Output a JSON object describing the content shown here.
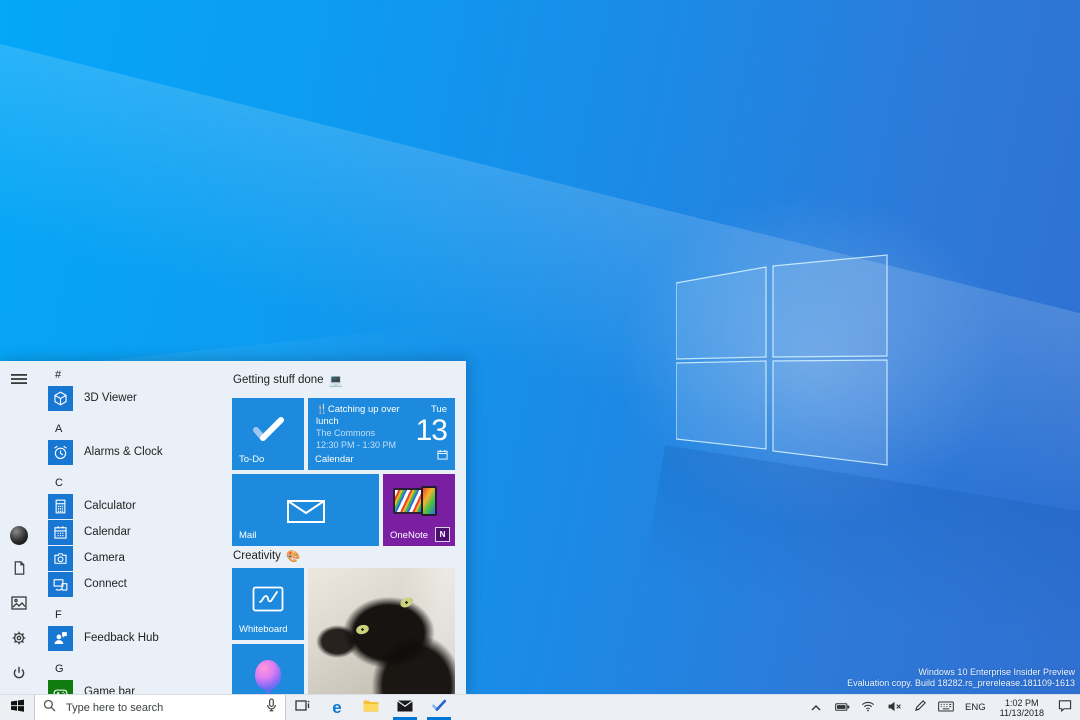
{
  "wallpaper": {
    "watermark_line1": "Windows 10 Enterprise Insider Preview",
    "watermark_line2": "Evaluation copy. Build 18282.rs_prerelease.181109-1613"
  },
  "colors": {
    "accent": "#0078d7",
    "tile_blue": "#1e8add",
    "app_icon_blue": "#1877d2",
    "onenote_purple": "#7a1fa2",
    "gamebar_green": "#107c10",
    "taskbar_bg": "#eceff4",
    "menu_bg": "#e9f0f7",
    "desktop_blue": "#0f9bef"
  },
  "icons": {
    "rail": [
      "hamburger-icon",
      "user-avatar",
      "documents-icon",
      "pictures-icon",
      "settings-gear-icon",
      "power-icon"
    ],
    "taskbar": [
      "start-icon",
      "search-icon",
      "microphone-icon",
      "task-view-icon",
      "edge-icon",
      "file-explorer-icon",
      "mail-icon",
      "todo-icon"
    ],
    "tray": [
      "chevron-up-icon",
      "battery-icon",
      "wifi-icon",
      "volume-muted-icon",
      "pen-icon",
      "touch-keyboard-icon",
      "action-center-icon"
    ]
  },
  "start_menu": {
    "sections": [
      {
        "letter": "#",
        "apps": [
          {
            "name": "3D Viewer"
          }
        ]
      },
      {
        "letter": "A",
        "apps": [
          {
            "name": "Alarms & Clock"
          }
        ]
      },
      {
        "letter": "C",
        "apps": [
          {
            "name": "Calculator"
          },
          {
            "name": "Calendar"
          },
          {
            "name": "Camera"
          },
          {
            "name": "Connect"
          }
        ]
      },
      {
        "letter": "F",
        "apps": [
          {
            "name": "Feedback Hub"
          }
        ]
      },
      {
        "letter": "G",
        "apps": [
          {
            "name": "Game bar"
          }
        ]
      }
    ],
    "groups": [
      {
        "title": "Getting stuff done",
        "emoji": "💻"
      },
      {
        "title": "Creativity",
        "emoji": "🎨"
      }
    ],
    "tiles": {
      "todo": {
        "label": "To-Do"
      },
      "calendar": {
        "label": "Calendar",
        "event_emoji": "🍴",
        "event_title": "Catching up over lunch",
        "event_location": "The Commons",
        "event_time": "12:30 PM - 1:30 PM",
        "weekday": "Tue",
        "day": "13"
      },
      "mail": {
        "label": "Mail"
      },
      "onenote": {
        "label": "OneNote",
        "badge": "N"
      },
      "whiteboard": {
        "label": "Whiteboard"
      }
    }
  },
  "taskbar": {
    "search_placeholder": "Type here to search",
    "edge_glyph": "e",
    "tray": {
      "language": "ENG",
      "time": "1:02 PM",
      "date": "11/13/2018"
    }
  }
}
